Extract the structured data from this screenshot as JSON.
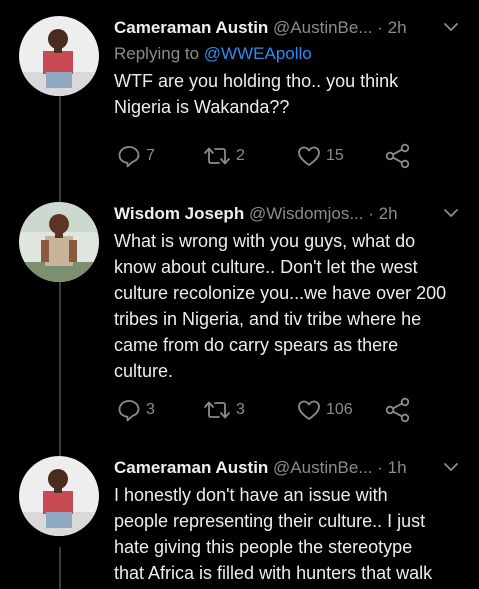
{
  "tweets": [
    {
      "name": "Cameraman Austin",
      "handle": "@AustinBe...",
      "dot": "·",
      "time": "2h",
      "reply_prefix": "Replying to",
      "reply_handle": "@WWEApollo",
      "text": "WTF are you holding tho.. you think\nNigeria is Wakanda??",
      "replies": "7",
      "retweets": "2",
      "likes": "15"
    },
    {
      "name": "Wisdom Joseph",
      "handle": "@Wisdomjos...",
      "dot": "·",
      "time": "2h",
      "text": "What is wrong with you guys, what do\nknow about culture.. Don't let the west\nculture recolonize you...we have over 200\ntribes in Nigeria, and tiv tribe where he\ncame from do carry spears as there\nculture.",
      "replies": "3",
      "retweets": "3",
      "likes": "106"
    },
    {
      "name": "Cameraman Austin",
      "handle": "@AustinBe...",
      "dot": "·",
      "time": "1h",
      "text": "I honestly don't have an issue with\npeople representing their culture.. I just\nhate giving this people the stereotype\nthat Africa is filled with hunters that walk"
    }
  ],
  "colors": {
    "background": "#000000",
    "primary_text": "#ededed",
    "secondary_text": "#8b8b8b",
    "link": "#2d8cf0",
    "thread_line": "#3a3a3a"
  },
  "icons": {
    "reply": "reply-icon",
    "retweet": "retweet-icon",
    "like": "heart-icon",
    "share": "share-icon",
    "more": "chevron-down-icon"
  }
}
